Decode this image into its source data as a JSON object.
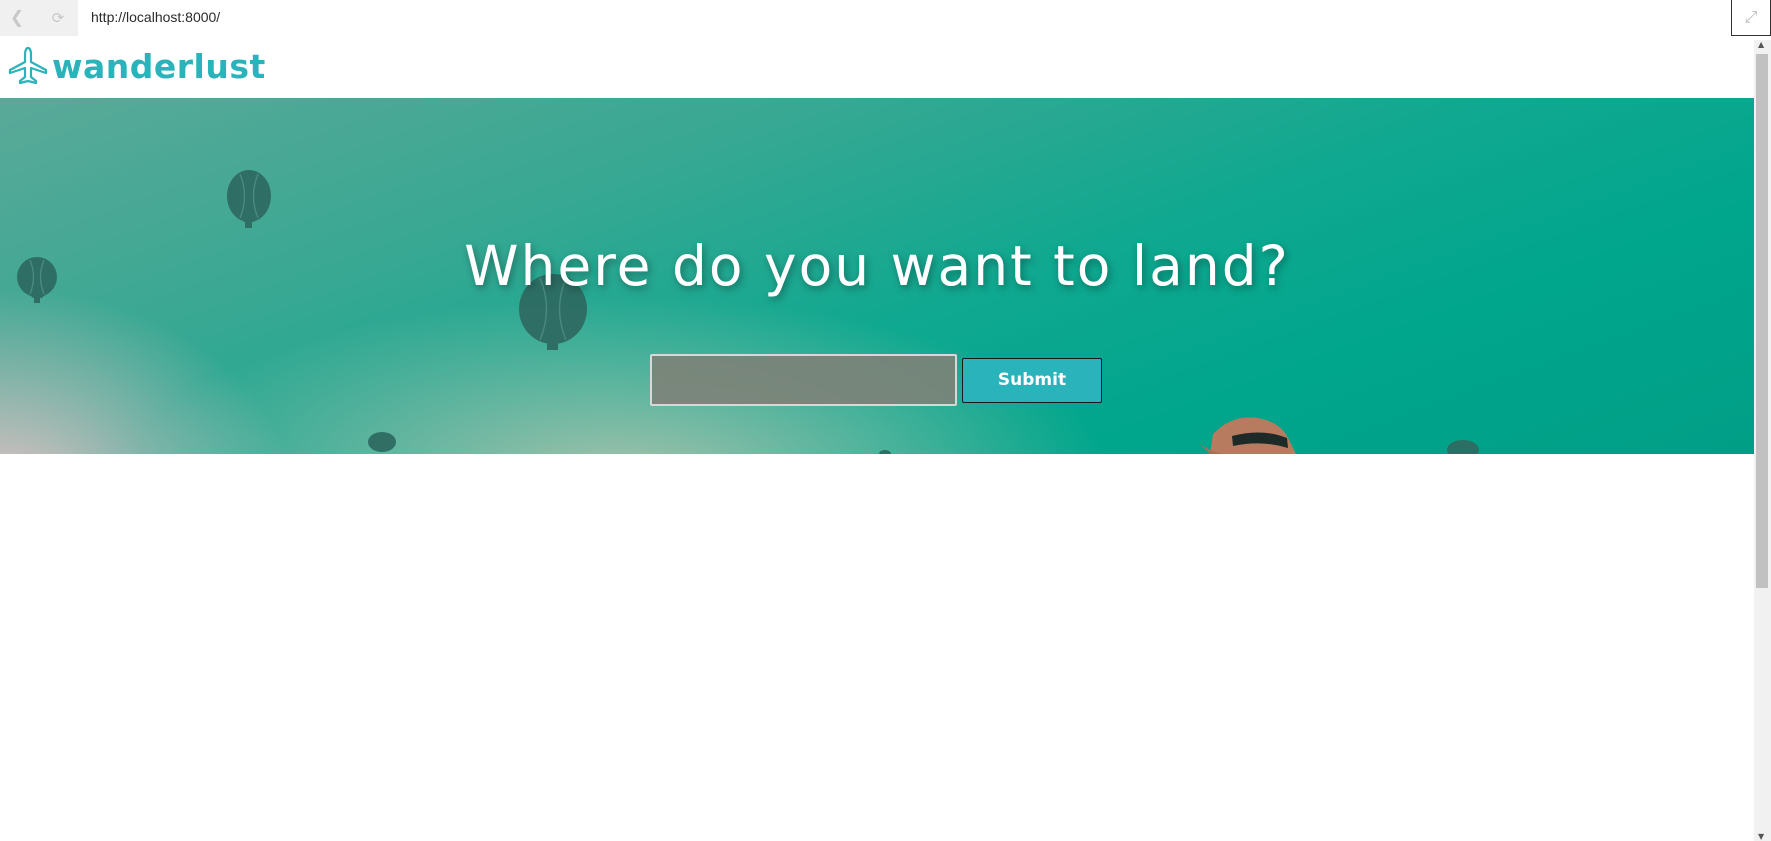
{
  "browser": {
    "url": "http://localhost:8000/",
    "icons": {
      "back": "back-arrow-icon",
      "reload": "reload-icon",
      "expand": "expand-icon"
    }
  },
  "header": {
    "logo_text": "wanderlust",
    "logo_icon": "airplane-icon",
    "brand_color": "#2ab3ba"
  },
  "hero": {
    "title": "Where do you want to land?",
    "search": {
      "placeholder": "",
      "value": ""
    },
    "submit_label": "Submit",
    "accent_color": "#00a68c"
  }
}
